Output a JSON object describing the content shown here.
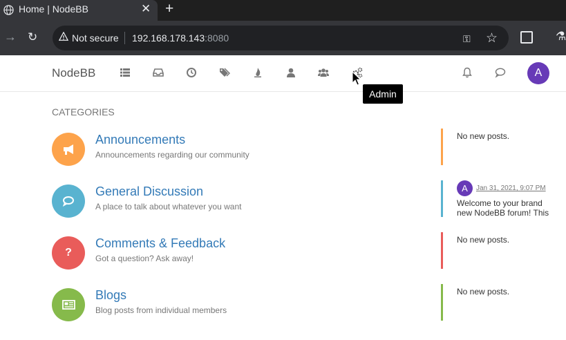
{
  "browser": {
    "tab_title": "Home | NodeBB",
    "tab_close": "✕",
    "new_tab": "+",
    "not_secure": "Not secure",
    "url_host": "192.168.178.143",
    "url_port": ":8080"
  },
  "header": {
    "brand": "NodeBB",
    "avatar_letter": "A"
  },
  "tooltip": "Admin",
  "main": {
    "section_title": "CATEGORIES",
    "categories": [
      {
        "name": "Announcements",
        "description": "Announcements regarding our community",
        "color": "#fda34b",
        "icon": "bullhorn-icon",
        "glyph": "📢",
        "teaser": "No new posts."
      },
      {
        "name": "General Discussion",
        "description": "A place to talk about whatever you want",
        "color": "#59b3d0",
        "icon": "comments-icon",
        "glyph": "💬",
        "teaser_avatar": "A",
        "teaser_time": "Jan 31, 2021, 9:07 PM",
        "teaser_text": "Welcome to your brand new NodeBB forum! This"
      },
      {
        "name": "Comments & Feedback",
        "description": "Got a question? Ask away!",
        "color": "#e95c5a",
        "icon": "question-icon",
        "glyph": "?",
        "teaser": "No new posts."
      },
      {
        "name": "Blogs",
        "description": "Blog posts from individual members",
        "color": "#86ba4b",
        "icon": "newspaper-icon",
        "glyph": "📰",
        "teaser": "No new posts."
      }
    ]
  },
  "colors": {
    "link": "#337ab7",
    "avatar": "#673ab7"
  }
}
